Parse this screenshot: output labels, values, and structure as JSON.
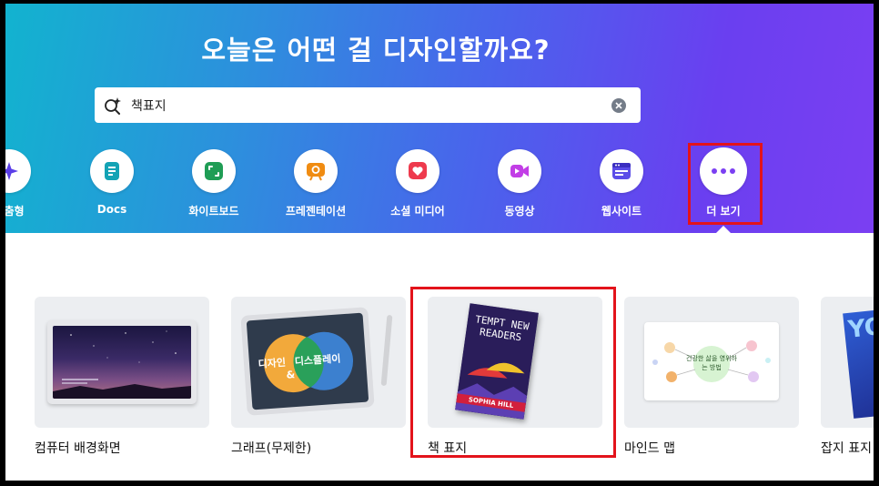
{
  "hero": {
    "title": "오늘은 어떤 걸 디자인할까요?"
  },
  "search": {
    "value": "책표지",
    "search_icon": "magic-search-icon",
    "clear_icon": "clear-icon"
  },
  "categories": [
    {
      "label": "맞춤형",
      "icon": "sparkle-icon",
      "color": "#5a3ee8"
    },
    {
      "label": "Docs",
      "icon": "docs-icon",
      "color": "#13a3b5"
    },
    {
      "label": "화이트보드",
      "icon": "whiteboard-icon",
      "color": "#1f9d55"
    },
    {
      "label": "프레젠테이션",
      "icon": "presentation-icon",
      "color": "#f08c12"
    },
    {
      "label": "소셜 미디어",
      "icon": "heart-icon",
      "color": "#ee3a4d"
    },
    {
      "label": "동영상",
      "icon": "video-icon",
      "color": "#c23ee6"
    },
    {
      "label": "웹사이트",
      "icon": "website-icon",
      "color": "#5b4de8"
    },
    {
      "label": "더 보기",
      "icon": "more-icon",
      "color": "#7b3ff2"
    }
  ],
  "cards": [
    {
      "label": "컴퓨터 배경화면"
    },
    {
      "label": "그래프(무제한)",
      "venn_left": "디자인",
      "venn_amp": "&",
      "venn_right": "디스플레이"
    },
    {
      "label": "책 표지",
      "book_title": "TEMPT NEW READERS",
      "book_author": "SOPHIA HILL"
    },
    {
      "label": "마인드 맵",
      "center_text": "건강한 삶을 영위하는 방법"
    },
    {
      "label": "잡지 표지",
      "cover_text": "YO"
    }
  ]
}
